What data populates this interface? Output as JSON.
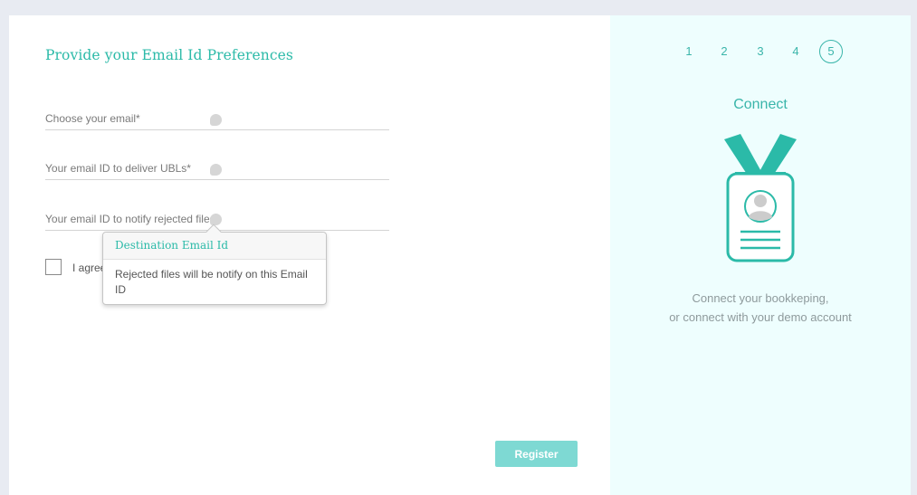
{
  "form": {
    "title": "Provide your Email Id Preferences",
    "fields": [
      {
        "placeholder": "Choose your email*",
        "value": ""
      },
      {
        "placeholder": "Your email ID to deliver UBLs*",
        "value": ""
      },
      {
        "placeholder": "Your email ID to notify rejected files*",
        "value": ""
      }
    ],
    "agree_label": "I agree",
    "register_label": "Register"
  },
  "tooltip": {
    "title": "Destination Email Id",
    "body": "Rejected files will be notify on this Email ID"
  },
  "sidebar": {
    "steps": [
      "1",
      "2",
      "3",
      "4",
      "5"
    ],
    "active_step": "5",
    "title": "Connect",
    "description_line1": "Connect your bookkeping,",
    "description_line2": "or connect with your demo account"
  },
  "colors": {
    "accent": "#2bbaa8",
    "sidebar_bg": "#eefefe",
    "button": "#7ed9d3"
  },
  "icons": {
    "info": "info-icon",
    "badge": "id-badge-icon"
  }
}
